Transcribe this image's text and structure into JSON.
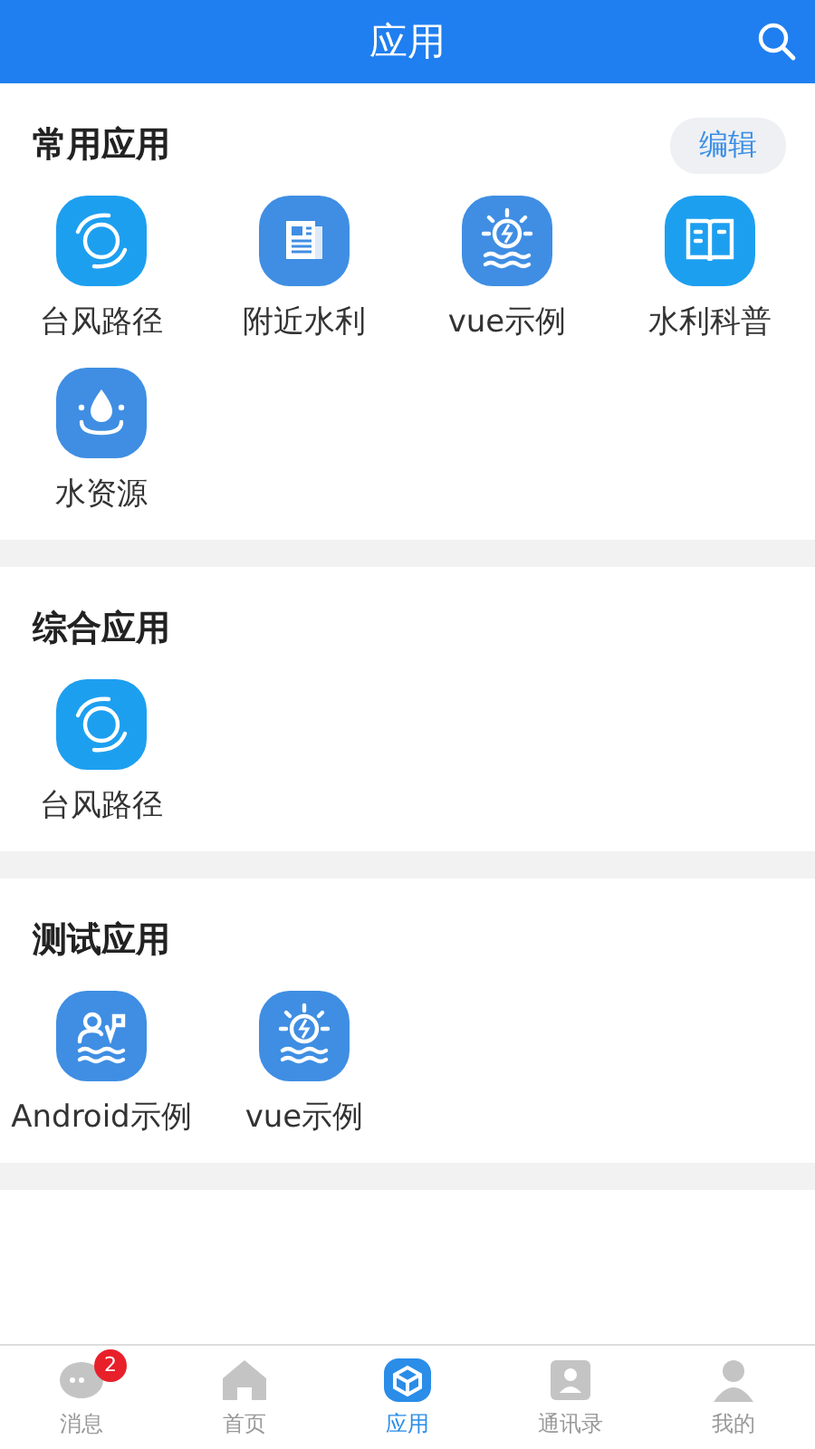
{
  "header": {
    "title": "应用"
  },
  "sections": [
    {
      "title": "常用应用",
      "action": "编辑",
      "apps": [
        {
          "label": "台风路径",
          "kind": "typhoon"
        },
        {
          "label": "附近水利",
          "kind": "news"
        },
        {
          "label": "vue示例",
          "kind": "hydro"
        },
        {
          "label": "水利科普",
          "kind": "book"
        },
        {
          "label": "水资源",
          "kind": "water"
        }
      ]
    },
    {
      "title": "综合应用",
      "apps": [
        {
          "label": "台风路径",
          "kind": "typhoon"
        }
      ]
    },
    {
      "title": "测试应用",
      "apps": [
        {
          "label": "Android示例",
          "kind": "survey"
        },
        {
          "label": "vue示例",
          "kind": "hydro"
        }
      ]
    }
  ],
  "tabs": [
    {
      "label": "消息",
      "kind": "chat",
      "selected": false,
      "badge": "2"
    },
    {
      "label": "首页",
      "kind": "home",
      "selected": false
    },
    {
      "label": "应用",
      "kind": "cube",
      "selected": true
    },
    {
      "label": "通讯录",
      "kind": "contacts",
      "selected": false
    },
    {
      "label": "我的",
      "kind": "person",
      "selected": false
    }
  ]
}
